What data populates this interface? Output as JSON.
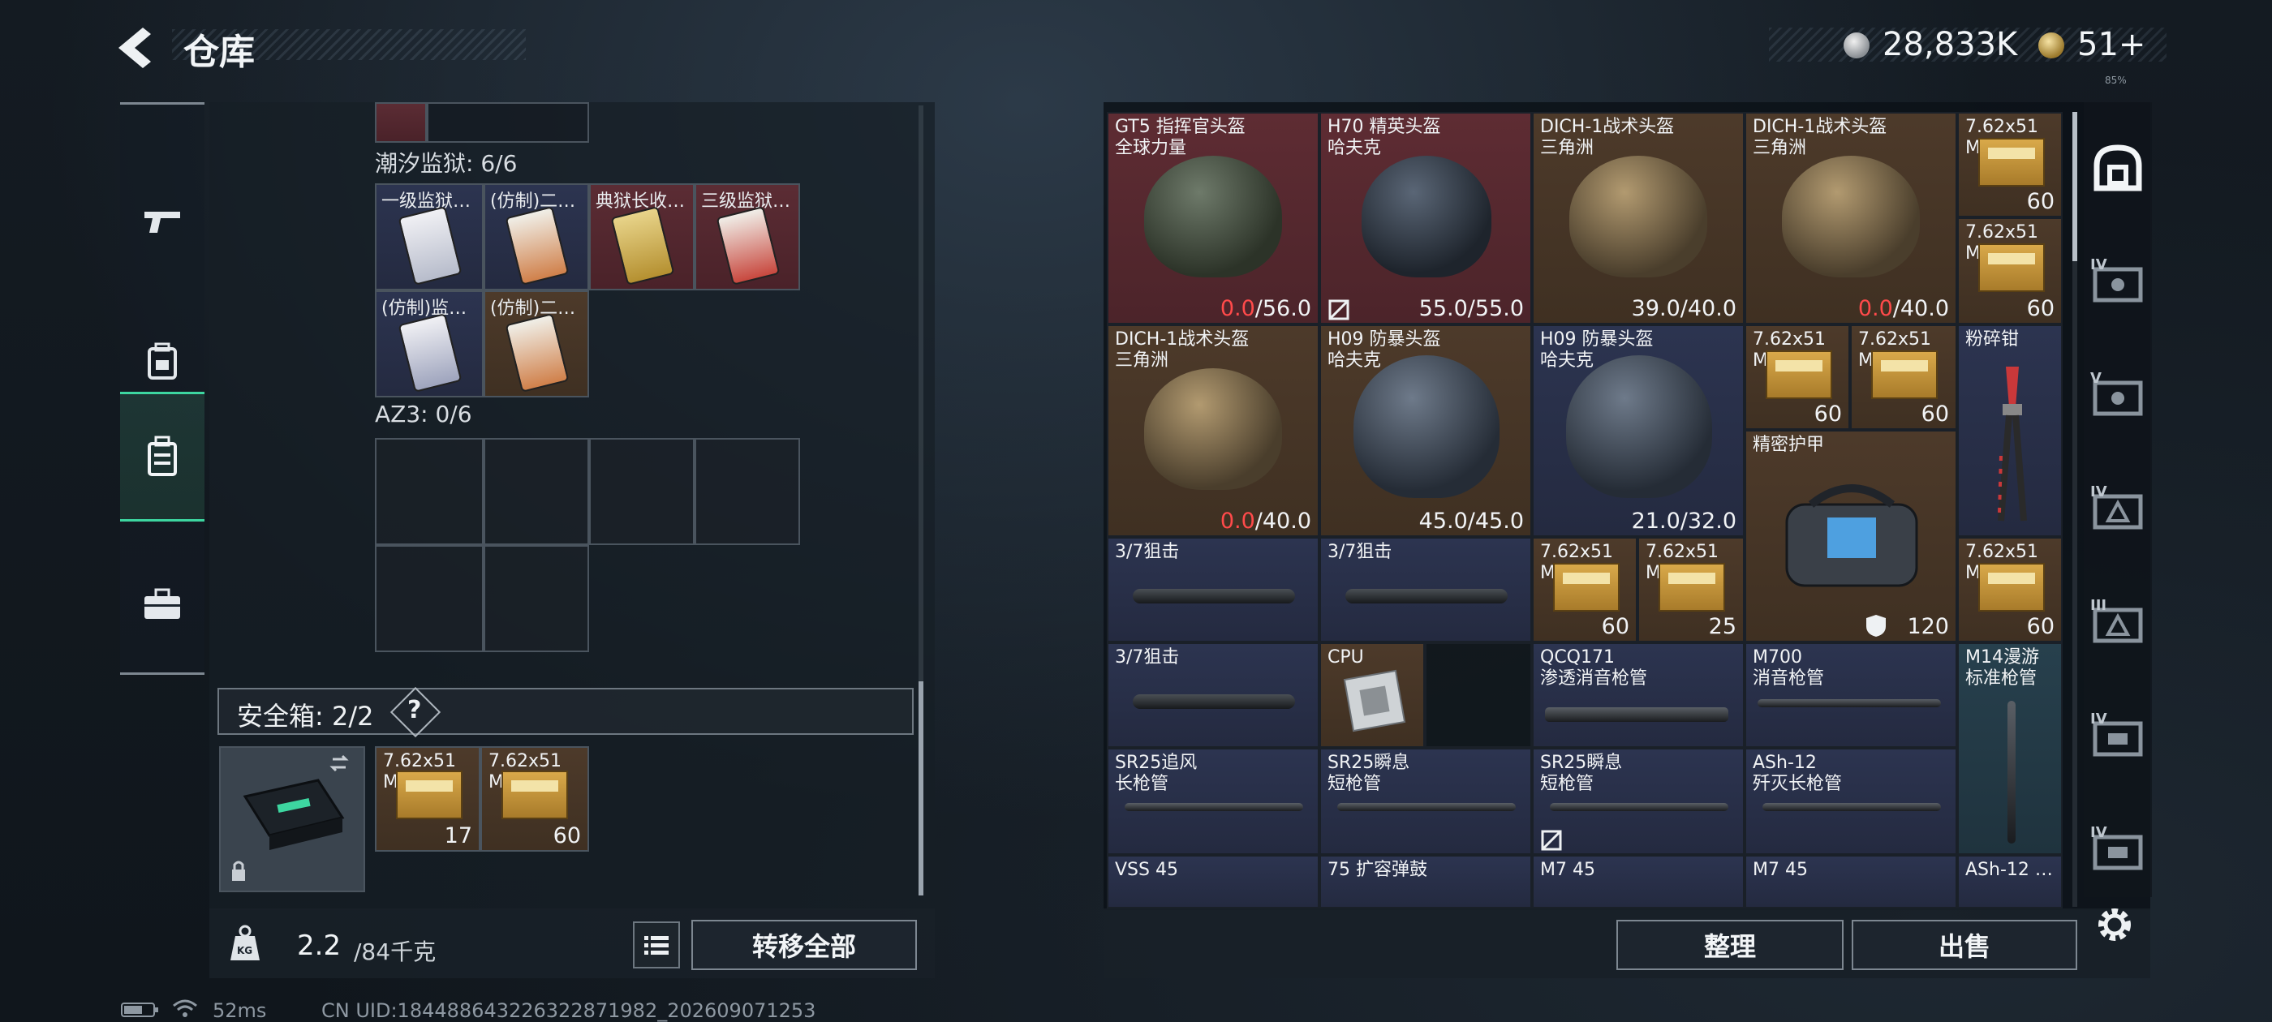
{
  "header": {
    "title": "仓库",
    "money": "28,833K",
    "tokens": "51+",
    "tiny": "85%"
  },
  "left_tabs": [
    {
      "name": "weapons-tab",
      "icon": "gun-icon"
    },
    {
      "name": "equipment-tab",
      "icon": "backpack-icon"
    },
    {
      "name": "keycard-tab",
      "icon": "keycard-case-icon",
      "active": true
    },
    {
      "name": "items-tab",
      "icon": "briefcase-icon"
    }
  ],
  "storage": {
    "section1_label": "潮汐监狱: 6/6",
    "section1_cards": [
      {
        "label": "一级监狱…",
        "color": "blue"
      },
      {
        "label": "(仿制)二…",
        "color": "blue"
      },
      {
        "label": "典狱长收…",
        "color": "red"
      },
      {
        "label": "三级监狱…",
        "color": "red"
      },
      {
        "label": "(仿制)监…",
        "color": "blue"
      },
      {
        "label": "(仿制)二…",
        "color": "brown"
      }
    ],
    "section2_label": "AZ3: 0/6",
    "safe_title": "安全箱: 2/2",
    "safe_help": "?",
    "safe_items": [
      {
        "name": "7.62x51",
        "sub": "M62",
        "count": "17"
      },
      {
        "name": "7.62x51",
        "sub": "M62",
        "count": "60"
      }
    ]
  },
  "bottom_left": {
    "weight_value": "2.2",
    "weight_unit": "/84千克",
    "transfer_all": "转移全部"
  },
  "status": {
    "ping": "52ms",
    "uid": "CN UID:18448864322632287198​2_202609071253"
  },
  "inventory": {
    "items": [
      {
        "name": "GT5 指挥官头盔",
        "sub": "全球力量",
        "dur_cur": "0.0",
        "dur_max": "/56.0",
        "cur_red": true
      },
      {
        "name": "H70 精英头盔",
        "sub": "哈夫克",
        "dur_cur": "55.0",
        "dur_max": "/55.0"
      },
      {
        "name": "DICH-1战术头盔",
        "sub": "三角洲",
        "dur_cur": "39.0",
        "dur_max": "/40.0"
      },
      {
        "name": "DICH-1战术头盔",
        "sub": "三角洲",
        "dur_cur": "0.0",
        "dur_max": "/40.0",
        "cur_red": true
      },
      {
        "name": "7.62x51",
        "sub": "M62",
        "count": "60"
      },
      {
        "name": "7.62x51",
        "sub": "M62",
        "count": "60"
      },
      {
        "name": "DICH-1战术头盔",
        "sub": "三角洲",
        "dur_cur": "0.0",
        "dur_max": "/40.0",
        "cur_red": true
      },
      {
        "name": "H09 防暴头盔",
        "sub": "哈夫克",
        "dur_cur": "45.0",
        "dur_max": "/45.0"
      },
      {
        "name": "H09 防暴头盔",
        "sub": "哈夫克",
        "dur_cur": "21.0",
        "dur_max": "/32.0"
      },
      {
        "name": "7.62x51",
        "sub": "M62",
        "count": "60"
      },
      {
        "name": "7.62x51",
        "sub": "M62",
        "count": "60"
      },
      {
        "name": "粉碎钳"
      },
      {
        "name": "精密护甲",
        "count": "120"
      },
      {
        "name": "3/7狙击"
      },
      {
        "name": "3/7狙击"
      },
      {
        "name": "7.62x51",
        "sub": "M62",
        "count": "60"
      },
      {
        "name": "7.62x51",
        "sub": "M62",
        "count": "25"
      },
      {
        "name": "7.62x51",
        "sub": "M62",
        "count": "60"
      },
      {
        "name": "3/7狙击"
      },
      {
        "name": "CPU"
      },
      {
        "name": "QCQ171",
        "sub": "渗透消音枪管"
      },
      {
        "name": "M700",
        "sub": "消音枪管"
      },
      {
        "name": "M14漫游",
        "sub": "标准枪管"
      },
      {
        "name": "SR25追风",
        "sub": "长枪管"
      },
      {
        "name": "SR25瞬息",
        "sub": "短枪管"
      },
      {
        "name": "SR25瞬息",
        "sub": "短枪管"
      },
      {
        "name": "ASh-12",
        "sub": "歼灭长枪管"
      },
      {
        "name": "VSS 45"
      },
      {
        "name": "75 扩容弹鼓"
      },
      {
        "name": "M7 45"
      },
      {
        "name": "M7 45"
      },
      {
        "name": "ASh-12 …"
      }
    ]
  },
  "bottom_right": {
    "organize": "整理",
    "sell": "出售"
  },
  "right_tabs": [
    {
      "tier": "",
      "icon": "all-items-icon"
    },
    {
      "tier": "IV",
      "icon": "container-icon"
    },
    {
      "tier": "V",
      "icon": "container-icon"
    },
    {
      "tier": "IV",
      "icon": "container-icon"
    },
    {
      "tier": "III",
      "icon": "container-icon"
    },
    {
      "tier": "IV",
      "icon": "container-icon"
    },
    {
      "tier": "IV",
      "icon": "container-icon"
    }
  ],
  "colors": {
    "accent_green": "#3dd6a0",
    "durability_red": "#ff4a4a",
    "rarity_red": "#5b2c34",
    "rarity_gold": "#4d3a2a",
    "rarity_blue": "#2c3450",
    "rarity_teal": "#27404d"
  }
}
